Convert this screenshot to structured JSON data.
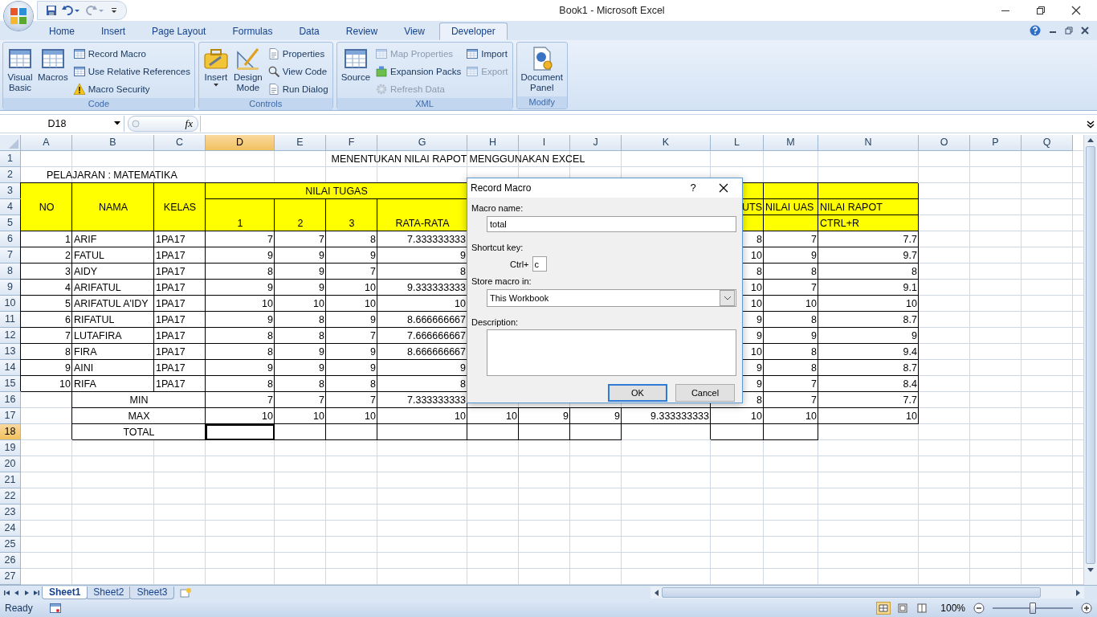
{
  "window": {
    "title": "Book1 - Microsoft Excel"
  },
  "tabs": [
    {
      "label": "Home",
      "selected": false
    },
    {
      "label": "Insert",
      "selected": false
    },
    {
      "label": "Page Layout",
      "selected": false
    },
    {
      "label": "Formulas",
      "selected": false
    },
    {
      "label": "Data",
      "selected": false
    },
    {
      "label": "Review",
      "selected": false
    },
    {
      "label": "View",
      "selected": false
    },
    {
      "label": "Developer",
      "selected": true
    }
  ],
  "ribbon_groups": [
    {
      "label": "Code",
      "buttons": [
        {
          "label": "Visual Basic",
          "kind": "large",
          "disabled": false
        },
        {
          "label": "Macros",
          "kind": "large",
          "disabled": false
        },
        {
          "label": "Record Macro",
          "kind": "small",
          "disabled": false
        },
        {
          "label": "Use Relative References",
          "kind": "small",
          "disabled": false
        },
        {
          "label": "Macro Security",
          "kind": "small",
          "disabled": false
        }
      ]
    },
    {
      "label": "Controls",
      "buttons": [
        {
          "label": "Insert",
          "kind": "large",
          "disabled": false
        },
        {
          "label": "Design Mode",
          "kind": "large",
          "disabled": false
        },
        {
          "label": "Properties",
          "kind": "small",
          "disabled": false
        },
        {
          "label": "View Code",
          "kind": "small",
          "disabled": false
        },
        {
          "label": "Run Dialog",
          "kind": "small",
          "disabled": false
        }
      ]
    },
    {
      "label": "XML",
      "buttons": [
        {
          "label": "Source",
          "kind": "large",
          "disabled": false
        },
        {
          "label": "Map Properties",
          "kind": "small",
          "disabled": true
        },
        {
          "label": "Expansion Packs",
          "kind": "small",
          "disabled": false
        },
        {
          "label": "Refresh Data",
          "kind": "small",
          "disabled": true
        },
        {
          "label": "Import",
          "kind": "small",
          "disabled": false
        },
        {
          "label": "Export",
          "kind": "small",
          "disabled": true
        }
      ]
    },
    {
      "label": "Modify",
      "buttons": [
        {
          "label": "Document Panel",
          "kind": "large",
          "disabled": false
        }
      ]
    }
  ],
  "formula_bar": {
    "name_box": "D18",
    "function_label": "fx"
  },
  "sheet": {
    "columns": [
      {
        "label": "A",
        "selected": false
      },
      {
        "label": "B",
        "selected": false
      },
      {
        "label": "C",
        "selected": false
      },
      {
        "label": "D",
        "selected": true
      },
      {
        "label": "E",
        "selected": false
      },
      {
        "label": "F",
        "selected": false
      },
      {
        "label": "G",
        "selected": false
      },
      {
        "label": "H",
        "selected": false
      },
      {
        "label": "I",
        "selected": false
      },
      {
        "label": "J",
        "selected": false
      },
      {
        "label": "K",
        "selected": false
      },
      {
        "label": "L",
        "selected": false
      },
      {
        "label": "M",
        "selected": false
      },
      {
        "label": "N",
        "selected": false
      },
      {
        "label": "O",
        "selected": false
      },
      {
        "label": "P",
        "selected": false
      },
      {
        "label": "Q",
        "selected": false
      }
    ],
    "rows": [
      {
        "label": "1",
        "selected": false,
        "cells": [
          {
            "kind": "blank"
          },
          {
            "kind": "blank"
          },
          {
            "kind": "blank"
          },
          {
            "kind": "title",
            "text": "MENENTUKAN NILAI RAPOT MENGGUNAKAN EXCEL"
          },
          {
            "kind": "merged"
          },
          {
            "kind": "merged"
          },
          {
            "kind": "merged"
          },
          {
            "kind": "merged"
          },
          {
            "kind": "merged"
          },
          {
            "kind": "merged"
          },
          {
            "kind": "merged"
          }
        ]
      },
      {
        "label": "2",
        "selected": false,
        "cells": [
          {
            "kind": "note",
            "text": "PELAJARAN : MATEMATIKA"
          },
          {
            "kind": "merged"
          },
          {
            "kind": "merged"
          }
        ]
      },
      {
        "label": "3",
        "selected": false,
        "cells": [
          {
            "kind": "header_top"
          },
          {
            "kind": "header_top"
          },
          {
            "kind": "header_top"
          },
          {
            "kind": "header",
            "text": "NILAI TUGAS"
          },
          {
            "kind": "merged"
          },
          {
            "kind": "merged"
          },
          {
            "kind": "merged"
          },
          {
            "kind": "blank"
          },
          {
            "kind": "blank"
          },
          {
            "kind": "blank"
          },
          {
            "kind": "blank"
          },
          {
            "kind": "header"
          },
          {
            "kind": "header"
          },
          {
            "kind": "header"
          }
        ]
      },
      {
        "label": "4",
        "selected": false,
        "cells": [
          {
            "kind": "header_mid",
            "text": "NO"
          },
          {
            "kind": "header_mid",
            "text": "NAMA"
          },
          {
            "kind": "header_mid",
            "text": "KELAS"
          },
          {
            "kind": "header_top"
          },
          {
            "kind": "header_top"
          },
          {
            "kind": "header_top"
          },
          {
            "kind": "header_top"
          },
          {
            "kind": "blank"
          },
          {
            "kind": "blank"
          },
          {
            "kind": "blank"
          },
          {
            "kind": "blank"
          },
          {
            "kind": "header_right",
            "text": "UTS"
          },
          {
            "kind": "header_left",
            "text": "NILAI UAS"
          },
          {
            "kind": "header_left",
            "text": "NILAI RAPOT"
          }
        ]
      },
      {
        "label": "5",
        "selected": false,
        "cells": [
          {
            "kind": "header_end"
          },
          {
            "kind": "header_end"
          },
          {
            "kind": "header_end"
          },
          {
            "kind": "header_end",
            "text": "1"
          },
          {
            "kind": "header_end",
            "text": "2"
          },
          {
            "kind": "header_end",
            "text": "3"
          },
          {
            "kind": "header_end",
            "text": "RATA-RATA"
          },
          {
            "kind": "blank"
          },
          {
            "kind": "blank"
          },
          {
            "kind": "blank"
          },
          {
            "kind": "blank"
          },
          {
            "kind": "header"
          },
          {
            "kind": "header"
          },
          {
            "kind": "header_left",
            "text": "CTRL+R"
          }
        ]
      },
      {
        "label": "6",
        "selected": false,
        "cells": [
          {
            "kind": "number",
            "text": "1"
          },
          {
            "kind": "text",
            "text": "ARIF"
          },
          {
            "kind": "text",
            "text": "1PA17"
          },
          {
            "kind": "number",
            "text": "7"
          },
          {
            "kind": "number",
            "text": "7"
          },
          {
            "kind": "number",
            "text": "8"
          },
          {
            "kind": "number",
            "text": "7.333333333"
          },
          {
            "kind": "blank"
          },
          {
            "kind": "blank"
          },
          {
            "kind": "blank"
          },
          {
            "kind": "blank"
          },
          {
            "kind": "number",
            "text": "8"
          },
          {
            "kind": "number",
            "text": "7"
          },
          {
            "kind": "number",
            "text": "7.7"
          }
        ]
      },
      {
        "label": "7",
        "selected": false,
        "cells": [
          {
            "kind": "number",
            "text": "2"
          },
          {
            "kind": "text",
            "text": "FATUL"
          },
          {
            "kind": "text",
            "text": "1PA17"
          },
          {
            "kind": "number",
            "text": "9"
          },
          {
            "kind": "number",
            "text": "9"
          },
          {
            "kind": "number",
            "text": "9"
          },
          {
            "kind": "number",
            "text": "9"
          },
          {
            "kind": "blank"
          },
          {
            "kind": "blank"
          },
          {
            "kind": "blank"
          },
          {
            "kind": "blank"
          },
          {
            "kind": "number",
            "text": "10"
          },
          {
            "kind": "number",
            "text": "9"
          },
          {
            "kind": "number",
            "text": "9.7"
          }
        ]
      },
      {
        "label": "8",
        "selected": false,
        "cells": [
          {
            "kind": "number",
            "text": "3"
          },
          {
            "kind": "text",
            "text": "AIDY"
          },
          {
            "kind": "text",
            "text": "1PA17"
          },
          {
            "kind": "number",
            "text": "8"
          },
          {
            "kind": "number",
            "text": "9"
          },
          {
            "kind": "number",
            "text": "7"
          },
          {
            "kind": "number",
            "text": "8"
          },
          {
            "kind": "blank"
          },
          {
            "kind": "blank"
          },
          {
            "kind": "blank"
          },
          {
            "kind": "blank"
          },
          {
            "kind": "number",
            "text": "8"
          },
          {
            "kind": "number",
            "text": "8"
          },
          {
            "kind": "number",
            "text": "8"
          }
        ]
      },
      {
        "label": "9",
        "selected": false,
        "cells": [
          {
            "kind": "number",
            "text": "4"
          },
          {
            "kind": "text",
            "text": "ARIFATUL"
          },
          {
            "kind": "text",
            "text": "1PA17"
          },
          {
            "kind": "number",
            "text": "9"
          },
          {
            "kind": "number",
            "text": "9"
          },
          {
            "kind": "number",
            "text": "10"
          },
          {
            "kind": "number",
            "text": "9.333333333"
          },
          {
            "kind": "blank"
          },
          {
            "kind": "blank"
          },
          {
            "kind": "blank"
          },
          {
            "kind": "blank"
          },
          {
            "kind": "number",
            "text": "10"
          },
          {
            "kind": "number",
            "text": "7"
          },
          {
            "kind": "number",
            "text": "9.1"
          }
        ]
      },
      {
        "label": "10",
        "selected": false,
        "cells": [
          {
            "kind": "number",
            "text": "5"
          },
          {
            "kind": "text",
            "text": "ARIFATUL A'IDY"
          },
          {
            "kind": "text",
            "text": "1PA17"
          },
          {
            "kind": "number",
            "text": "10"
          },
          {
            "kind": "number",
            "text": "10"
          },
          {
            "kind": "number",
            "text": "10"
          },
          {
            "kind": "number",
            "text": "10"
          },
          {
            "kind": "blank"
          },
          {
            "kind": "blank"
          },
          {
            "kind": "blank"
          },
          {
            "kind": "blank"
          },
          {
            "kind": "number",
            "text": "10"
          },
          {
            "kind": "number",
            "text": "10"
          },
          {
            "kind": "number",
            "text": "10"
          }
        ]
      },
      {
        "label": "11",
        "selected": false,
        "cells": [
          {
            "kind": "number",
            "text": "6"
          },
          {
            "kind": "text",
            "text": "RIFATUL"
          },
          {
            "kind": "text",
            "text": "1PA17"
          },
          {
            "kind": "number",
            "text": "9"
          },
          {
            "kind": "number",
            "text": "8"
          },
          {
            "kind": "number",
            "text": "9"
          },
          {
            "kind": "number",
            "text": "8.666666667"
          },
          {
            "kind": "blank"
          },
          {
            "kind": "blank"
          },
          {
            "kind": "blank"
          },
          {
            "kind": "blank"
          },
          {
            "kind": "number",
            "text": "9"
          },
          {
            "kind": "number",
            "text": "8"
          },
          {
            "kind": "number",
            "text": "8.7"
          }
        ]
      },
      {
        "label": "12",
        "selected": false,
        "cells": [
          {
            "kind": "number",
            "text": "7"
          },
          {
            "kind": "text",
            "text": "LUTAFIRA"
          },
          {
            "kind": "text",
            "text": "1PA17"
          },
          {
            "kind": "number",
            "text": "8"
          },
          {
            "kind": "number",
            "text": "8"
          },
          {
            "kind": "number",
            "text": "7"
          },
          {
            "kind": "number",
            "text": "7.666666667"
          },
          {
            "kind": "blank"
          },
          {
            "kind": "blank"
          },
          {
            "kind": "blank"
          },
          {
            "kind": "blank"
          },
          {
            "kind": "number",
            "text": "9"
          },
          {
            "kind": "number",
            "text": "9"
          },
          {
            "kind": "number",
            "text": "9"
          }
        ]
      },
      {
        "label": "13",
        "selected": false,
        "cells": [
          {
            "kind": "number",
            "text": "8"
          },
          {
            "kind": "text",
            "text": "FIRA"
          },
          {
            "kind": "text",
            "text": "1PA17"
          },
          {
            "kind": "number",
            "text": "8"
          },
          {
            "kind": "number",
            "text": "9"
          },
          {
            "kind": "number",
            "text": "9"
          },
          {
            "kind": "number",
            "text": "8.666666667"
          },
          {
            "kind": "blank"
          },
          {
            "kind": "blank"
          },
          {
            "kind": "blank"
          },
          {
            "kind": "blank"
          },
          {
            "kind": "number",
            "text": "10"
          },
          {
            "kind": "number",
            "text": "8"
          },
          {
            "kind": "number",
            "text": "9.4"
          }
        ]
      },
      {
        "label": "14",
        "selected": false,
        "cells": [
          {
            "kind": "number",
            "text": "9"
          },
          {
            "kind": "text",
            "text": "AINI"
          },
          {
            "kind": "text",
            "text": "1PA17"
          },
          {
            "kind": "number",
            "text": "9"
          },
          {
            "kind": "number",
            "text": "9"
          },
          {
            "kind": "number",
            "text": "9"
          },
          {
            "kind": "number",
            "text": "9"
          },
          {
            "kind": "blank"
          },
          {
            "kind": "blank"
          },
          {
            "kind": "blank"
          },
          {
            "kind": "blank"
          },
          {
            "kind": "number",
            "text": "9"
          },
          {
            "kind": "number",
            "text": "8"
          },
          {
            "kind": "number",
            "text": "8.7"
          }
        ]
      },
      {
        "label": "15",
        "selected": false,
        "cells": [
          {
            "kind": "number",
            "text": "10"
          },
          {
            "kind": "text",
            "text": "RIFA"
          },
          {
            "kind": "text",
            "text": "1PA17"
          },
          {
            "kind": "number",
            "text": "8"
          },
          {
            "kind": "number",
            "text": "8"
          },
          {
            "kind": "number",
            "text": "8"
          },
          {
            "kind": "number",
            "text": "8"
          },
          {
            "kind": "blank"
          },
          {
            "kind": "blank"
          },
          {
            "kind": "blank"
          },
          {
            "kind": "blank"
          },
          {
            "kind": "number",
            "text": "9"
          },
          {
            "kind": "number",
            "text": "7"
          },
          {
            "kind": "number",
            "text": "8.4"
          }
        ]
      },
      {
        "label": "16",
        "selected": false,
        "cells": [
          {
            "kind": "blank"
          },
          {
            "kind": "label",
            "text": "MIN"
          },
          {
            "kind": "merged"
          },
          {
            "kind": "number",
            "text": "7"
          },
          {
            "kind": "number",
            "text": "7"
          },
          {
            "kind": "number",
            "text": "7"
          },
          {
            "kind": "number",
            "text": "7.333333333"
          },
          {
            "kind": "blank"
          },
          {
            "kind": "blank"
          },
          {
            "kind": "blank"
          },
          {
            "kind": "blank"
          },
          {
            "kind": "number",
            "text": "8"
          },
          {
            "kind": "number",
            "text": "7"
          },
          {
            "kind": "number",
            "text": "7.7"
          }
        ]
      },
      {
        "label": "17",
        "selected": false,
        "cells": [
          {
            "kind": "blank"
          },
          {
            "kind": "label",
            "text": "MAX"
          },
          {
            "kind": "merged"
          },
          {
            "kind": "number",
            "text": "10"
          },
          {
            "kind": "number",
            "text": "10"
          },
          {
            "kind": "number",
            "text": "10"
          },
          {
            "kind": "number",
            "text": "10"
          },
          {
            "kind": "number",
            "text": "10"
          },
          {
            "kind": "number",
            "text": "9"
          },
          {
            "kind": "number",
            "text": "9"
          },
          {
            "kind": "number",
            "text": "9.333333333"
          },
          {
            "kind": "number",
            "text": "10"
          },
          {
            "kind": "number",
            "text": "10"
          },
          {
            "kind": "number",
            "text": "10"
          }
        ]
      },
      {
        "label": "18",
        "selected": true,
        "cells": [
          {
            "kind": "blank"
          },
          {
            "kind": "label",
            "text": "TOTAL"
          },
          {
            "kind": "merged"
          },
          {
            "kind": "empty"
          },
          {
            "kind": "empty"
          },
          {
            "kind": "empty"
          },
          {
            "kind": "empty"
          },
          {
            "kind": "empty"
          },
          {
            "kind": "empty"
          },
          {
            "kind": "empty"
          },
          {
            "kind": "blank"
          },
          {
            "kind": "empty"
          },
          {
            "kind": "empty"
          }
        ]
      },
      {
        "label": "19",
        "selected": false
      },
      {
        "label": "20",
        "selected": false
      },
      {
        "label": "21",
        "selected": false
      },
      {
        "label": "22",
        "selected": false
      },
      {
        "label": "23",
        "selected": false
      },
      {
        "label": "24",
        "selected": false
      },
      {
        "label": "25",
        "selected": false
      },
      {
        "label": "26",
        "selected": false
      },
      {
        "label": "27",
        "selected": false
      }
    ]
  },
  "dialog": {
    "title": "Record Macro",
    "help": "?",
    "macro_name_label": "Macro name:",
    "macro_name": "total",
    "shortcut_label": "Shortcut key:",
    "shortcut_prefix": "Ctrl+",
    "shortcut_key": "c",
    "store_label": "Store macro in:",
    "store_value": "This Workbook",
    "description_label": "Description:",
    "buttons": [
      {
        "label": "OK",
        "kind": "default"
      },
      {
        "label": "Cancel",
        "kind": "normal"
      }
    ]
  },
  "sheet_tabs": [
    {
      "label": "Sheet1",
      "selected": true
    },
    {
      "label": "Sheet2",
      "selected": false
    },
    {
      "label": "Sheet3",
      "selected": false
    }
  ],
  "status_bar": {
    "status": "Ready",
    "zoom": "100%",
    "level": 0.5
  }
}
